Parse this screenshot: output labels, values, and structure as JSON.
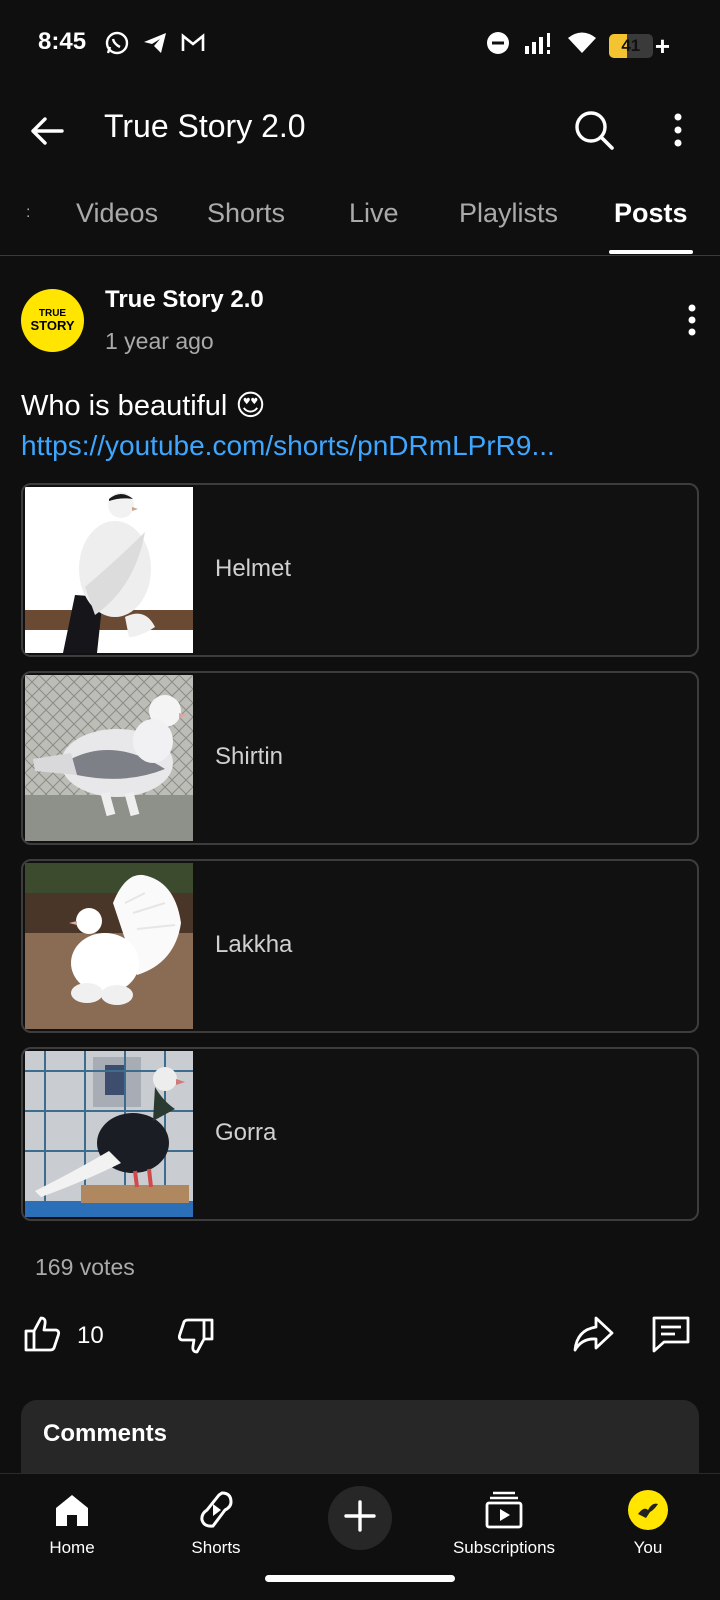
{
  "status_bar": {
    "time": "8:45",
    "battery_level": "41",
    "battery_fraction": 0.41,
    "app_icons": [
      "whatsapp-icon",
      "telegram-icon",
      "gmail-icon"
    ],
    "indicators": [
      "dnd-icon",
      "signal-icon",
      "wifi-icon",
      "battery-icon"
    ]
  },
  "app_bar": {
    "title": "True Story 2.0",
    "icons": [
      "back-arrow-icon",
      "search-icon",
      "more-vert-icon"
    ]
  },
  "tabs": {
    "items": [
      {
        "label": ":",
        "active": false
      },
      {
        "label": "Videos",
        "active": false
      },
      {
        "label": "Shorts",
        "active": false
      },
      {
        "label": "Live",
        "active": false
      },
      {
        "label": "Playlists",
        "active": false
      },
      {
        "label": "Posts",
        "active": true
      }
    ]
  },
  "post": {
    "avatar_text": {
      "line1": "TRUE",
      "line2": "STORY"
    },
    "author": "True Story 2.0",
    "time": "1 year ago",
    "text": "Who is beautiful 😍",
    "link": "https://youtube.com/shorts/pnDRmLPrR9...",
    "poll": {
      "options": [
        {
          "label": "Helmet",
          "image": "white-pigeon-black-tail"
        },
        {
          "label": "Shirtin",
          "image": "grey-spotted-pigeon"
        },
        {
          "label": "Lakkha",
          "image": "white-fantail-pigeon"
        },
        {
          "label": "Gorra",
          "image": "black-white-pigeon"
        }
      ],
      "votes": "169 votes"
    },
    "actions": {
      "like_count": "10",
      "icons": [
        "thumbs-up-icon",
        "thumbs-down-icon",
        "share-icon",
        "comment-icon"
      ]
    }
  },
  "comments": {
    "title": "Comments"
  },
  "bottom_nav": {
    "items": [
      {
        "label": "Home",
        "icon": "home-icon",
        "active": true
      },
      {
        "label": "Shorts",
        "icon": "shorts-icon",
        "active": false
      },
      {
        "label": "",
        "icon": "create-plus-icon",
        "active": false
      },
      {
        "label": "Subscriptions",
        "icon": "subscriptions-icon",
        "active": false
      },
      {
        "label": "You",
        "icon": "you-avatar-icon",
        "active": false
      }
    ]
  },
  "colors": {
    "background": "#0f0f0f",
    "link": "#3ea6ff",
    "secondary_text": "#aaaaaa",
    "card": "#272727",
    "avatar": "#ffe500",
    "battery": "#f4c430"
  }
}
